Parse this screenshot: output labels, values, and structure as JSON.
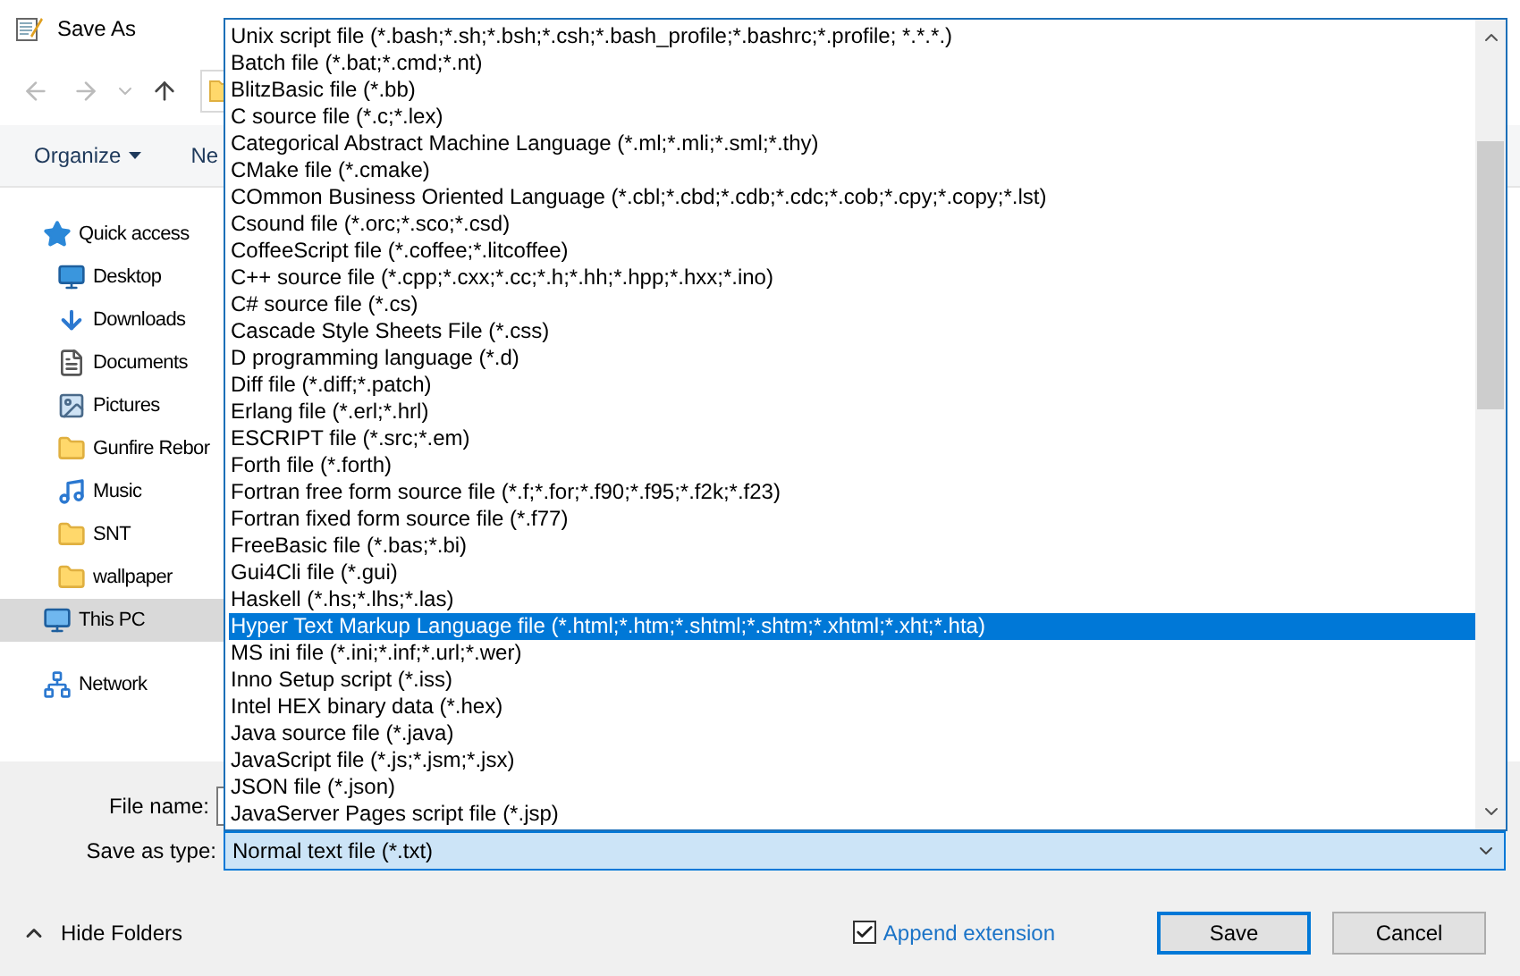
{
  "window": {
    "title": "Save As"
  },
  "toolbar": {
    "organize": "Organize",
    "new_folder": "Ne"
  },
  "nav_pane": [
    {
      "label": "Quick access",
      "kind": "star",
      "selected": false,
      "children": [
        {
          "label": "Desktop",
          "kind": "desktop",
          "selected": false
        },
        {
          "label": "Downloads",
          "kind": "download",
          "selected": false
        },
        {
          "label": "Documents",
          "kind": "document",
          "selected": false
        },
        {
          "label": "Pictures",
          "kind": "picture",
          "selected": false
        },
        {
          "label": "Gunfire Rebor",
          "kind": "folder",
          "selected": false
        },
        {
          "label": "Music",
          "kind": "music",
          "selected": false
        },
        {
          "label": "SNT",
          "kind": "folder",
          "selected": false
        },
        {
          "label": "wallpaper",
          "kind": "folder",
          "selected": false
        }
      ]
    },
    {
      "label": "This PC",
      "kind": "pc",
      "selected": true
    },
    {
      "label": "Network",
      "kind": "network",
      "selected": false
    }
  ],
  "file_name": {
    "label": "File name:"
  },
  "save_as_type": {
    "label": "Save as type:",
    "value": "Normal text file (*.txt)"
  },
  "dropdown": {
    "options": [
      {
        "label": "Unix script file (*.bash;*.sh;*.bsh;*.csh;*.bash_profile;*.bashrc;*.profile; *.*.*.)",
        "selected": false
      },
      {
        "label": "Batch file (*.bat;*.cmd;*.nt)",
        "selected": false
      },
      {
        "label": "BlitzBasic file (*.bb)",
        "selected": false
      },
      {
        "label": "C source file (*.c;*.lex)",
        "selected": false
      },
      {
        "label": "Categorical Abstract Machine Language (*.ml;*.mli;*.sml;*.thy)",
        "selected": false
      },
      {
        "label": "CMake file (*.cmake)",
        "selected": false
      },
      {
        "label": "COmmon Business Oriented Language (*.cbl;*.cbd;*.cdb;*.cdc;*.cob;*.cpy;*.copy;*.lst)",
        "selected": false
      },
      {
        "label": "Csound file (*.orc;*.sco;*.csd)",
        "selected": false
      },
      {
        "label": "CoffeeScript file (*.coffee;*.litcoffee)",
        "selected": false
      },
      {
        "label": "C++ source file (*.cpp;*.cxx;*.cc;*.h;*.hh;*.hpp;*.hxx;*.ino)",
        "selected": false
      },
      {
        "label": "C# source file (*.cs)",
        "selected": false
      },
      {
        "label": "Cascade Style Sheets File (*.css)",
        "selected": false
      },
      {
        "label": "D programming language (*.d)",
        "selected": false
      },
      {
        "label": "Diff file (*.diff;*.patch)",
        "selected": false
      },
      {
        "label": "Erlang file (*.erl;*.hrl)",
        "selected": false
      },
      {
        "label": "ESCRIPT file (*.src;*.em)",
        "selected": false
      },
      {
        "label": "Forth file (*.forth)",
        "selected": false
      },
      {
        "label": "Fortran free form source file (*.f;*.for;*.f90;*.f95;*.f2k;*.f23)",
        "selected": false
      },
      {
        "label": "Fortran fixed form source file (*.f77)",
        "selected": false
      },
      {
        "label": "FreeBasic file (*.bas;*.bi)",
        "selected": false
      },
      {
        "label": "Gui4Cli file (*.gui)",
        "selected": false
      },
      {
        "label": "Haskell (*.hs;*.lhs;*.las)",
        "selected": false
      },
      {
        "label": "Hyper Text Markup Language file (*.html;*.htm;*.shtml;*.shtm;*.xhtml;*.xht;*.hta)",
        "selected": true
      },
      {
        "label": "MS ini file (*.ini;*.inf;*.url;*.wer)",
        "selected": false
      },
      {
        "label": "Inno Setup script (*.iss)",
        "selected": false
      },
      {
        "label": "Intel HEX binary data (*.hex)",
        "selected": false
      },
      {
        "label": "Java source file (*.java)",
        "selected": false
      },
      {
        "label": "JavaScript file (*.js;*.jsm;*.jsx)",
        "selected": false
      },
      {
        "label": "JSON file (*.json)",
        "selected": false
      },
      {
        "label": "JavaServer Pages script file (*.jsp)",
        "selected": false
      }
    ]
  },
  "hide_folders": "Hide Folders",
  "append_extension": {
    "label": "Append extension",
    "checked": true
  },
  "buttons": [
    {
      "label": "Save",
      "default": true
    },
    {
      "label": "Cancel",
      "default": false
    }
  ]
}
